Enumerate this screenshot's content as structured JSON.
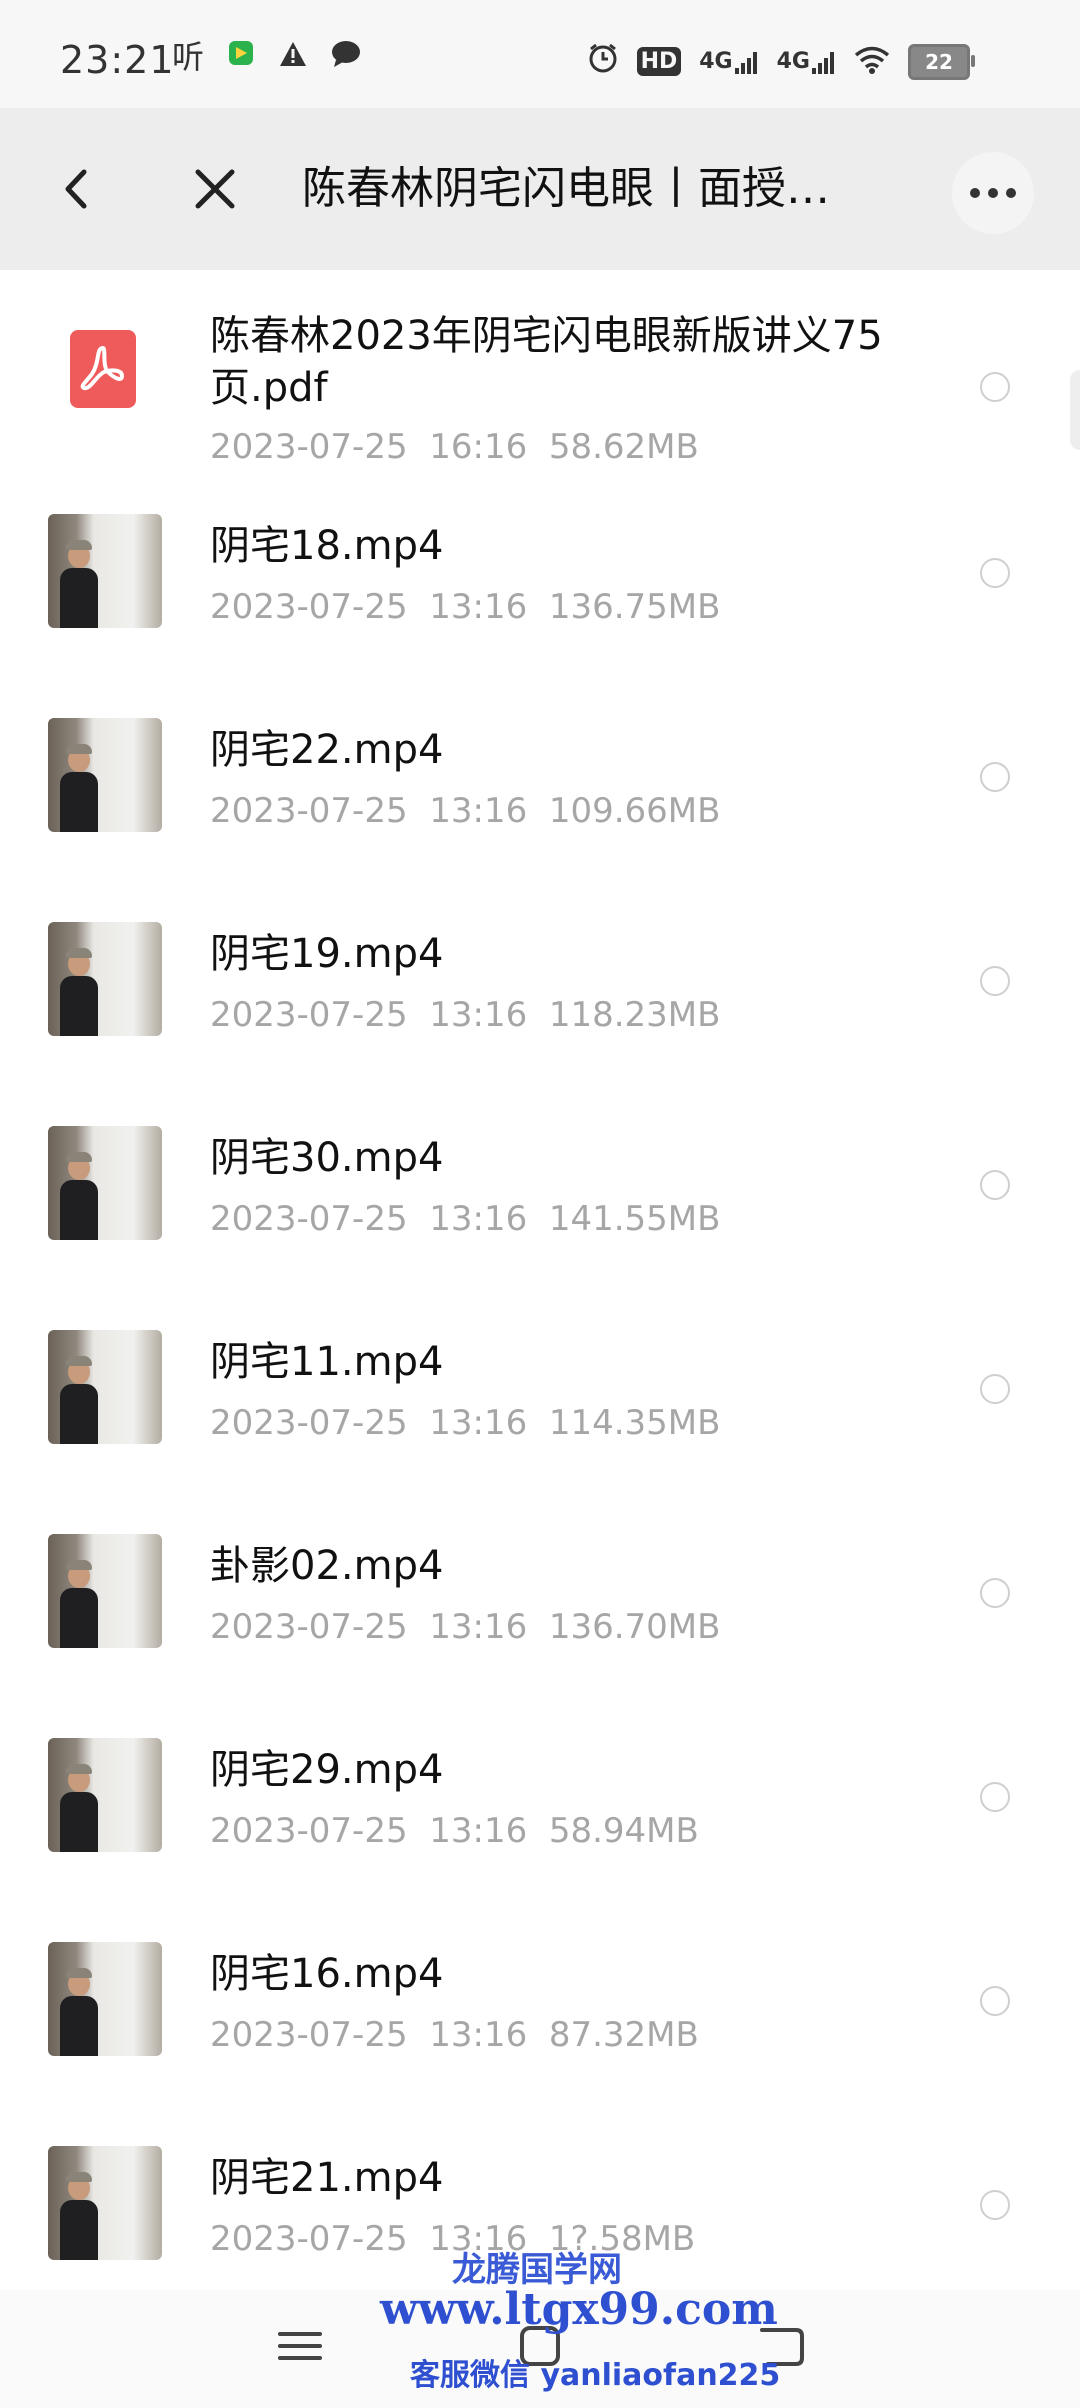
{
  "status_bar": {
    "time": "23:21",
    "listen_label": "听",
    "hd_label": "HD",
    "signal1_label": "4G",
    "signal2_label": "4G",
    "battery_level": "22"
  },
  "nav": {
    "title": "陈春林阴宅闪电眼丨面授…"
  },
  "files": [
    {
      "name": "陈春林2023年阴宅闪电眼新版讲义75页.pdf",
      "date": "2023-07-25",
      "time": "16:16",
      "size": "58.62MB",
      "type": "pdf"
    },
    {
      "name": "阴宅18.mp4",
      "date": "2023-07-25",
      "time": "13:16",
      "size": "136.75MB",
      "type": "video"
    },
    {
      "name": "阴宅22.mp4",
      "date": "2023-07-25",
      "time": "13:16",
      "size": "109.66MB",
      "type": "video"
    },
    {
      "name": "阴宅19.mp4",
      "date": "2023-07-25",
      "time": "13:16",
      "size": "118.23MB",
      "type": "video"
    },
    {
      "name": "阴宅30.mp4",
      "date": "2023-07-25",
      "time": "13:16",
      "size": "141.55MB",
      "type": "video"
    },
    {
      "name": "阴宅11.mp4",
      "date": "2023-07-25",
      "time": "13:16",
      "size": "114.35MB",
      "type": "video"
    },
    {
      "name": "卦影02.mp4",
      "date": "2023-07-25",
      "time": "13:16",
      "size": "136.70MB",
      "type": "video"
    },
    {
      "name": "阴宅29.mp4",
      "date": "2023-07-25",
      "time": "13:16",
      "size": "58.94MB",
      "type": "video"
    },
    {
      "name": "阴宅16.mp4",
      "date": "2023-07-25",
      "time": "13:16",
      "size": "87.32MB",
      "type": "video"
    },
    {
      "name": "阴宅21.mp4",
      "date": "2023-07-25",
      "time": "13:16",
      "size": "1?.58MB",
      "type": "video"
    }
  ],
  "watermark": {
    "line1": "龙腾国学网",
    "line2": "www.ltgx99.com",
    "line3": "客服微信 yanliaofan225"
  },
  "icons": {
    "back": "chevron-left-icon",
    "close": "close-icon",
    "more": "more-icon",
    "menu": "menu-icon",
    "home": "home-icon",
    "return": "back-icon"
  },
  "colors": {
    "nav_bg": "#ededed",
    "meta_text": "#a6a6a6",
    "pdf_red": "#ef5a5a",
    "watermark_blue": "#2f4fd1"
  }
}
